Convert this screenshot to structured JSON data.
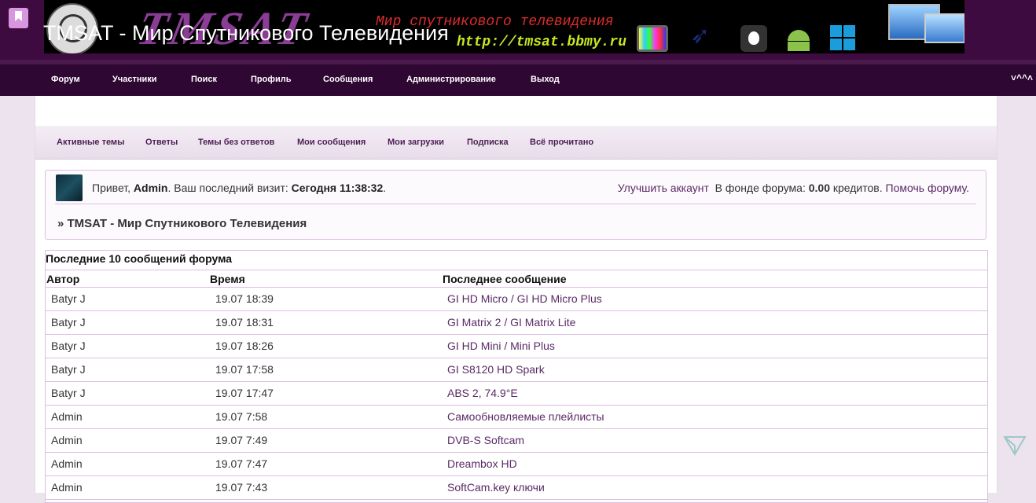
{
  "header": {
    "site_title": "TMSAT - Мир Спутникового Телевидения",
    "banner_logo": "TMSAT",
    "banner_tagline": "Мир спутникового телевидения",
    "banner_url": "http://tmsat.bbmy.ru",
    "icons": [
      "bookmark-icon",
      "satellite-dish-icon",
      "tv-icon",
      "rocket-icon",
      "apple-icon",
      "android-icon",
      "windows-icon",
      "computer-icon"
    ]
  },
  "nav": {
    "items": [
      "Форум",
      "Участники",
      "Поиск",
      "Профиль",
      "Сообщения",
      "Администрирование",
      "Выход"
    ],
    "scroll_label": "˅^^˄"
  },
  "subnav": {
    "items": [
      "Активные темы",
      "Ответы",
      "Темы без ответов",
      "Мои сообщения",
      "Мои загрузки",
      "Подписка",
      "Всё прочитано"
    ]
  },
  "welcome": {
    "greet_prefix": "Привет,",
    "username": "Admin",
    "last_visit_label": ". Ваш последний визит:",
    "last_visit_value": "Сегодня 11:38:32",
    "upgrade_link": "Улучшить аккаунт",
    "fund_label": "В фонде форума:",
    "fund_value": "0.00",
    "fund_unit": "кредитов.",
    "help_link": "Помочь форуму.",
    "crumb": "» TMSAT - Мир Спутникового Телевидения"
  },
  "latest": {
    "title": "Последние 10 сообщений форума",
    "columns": [
      "Автор",
      "Время",
      "Последнее сообщение"
    ],
    "rows": [
      {
        "author": "Batyr J",
        "time": "19.07 18:39",
        "message": "GI HD Micro / GI HD Micro Plus"
      },
      {
        "author": "Batyr J",
        "time": "19.07 18:31",
        "message": "GI Matrix 2 / GI Matrix Lite"
      },
      {
        "author": "Batyr J",
        "time": "19.07 18:26",
        "message": "GI HD Mini / Mini Plus"
      },
      {
        "author": "Batyr J",
        "time": "19.07 17:58",
        "message": "GI S8120 HD Spark"
      },
      {
        "author": "Batyr J",
        "time": "19.07 17:47",
        "message": "ABS 2, 74.9°E"
      },
      {
        "author": "Admin",
        "time": "19.07 7:58",
        "message": "Самообновляемые плейлисты"
      },
      {
        "author": "Admin",
        "time": "19.07 7:49",
        "message": "DVB-S Softcam"
      },
      {
        "author": "Admin",
        "time": "19.07 7:47",
        "message": "Dreambox HD"
      },
      {
        "author": "Admin",
        "time": "19.07 7:43",
        "message": "SoftCam.key ключи"
      }
    ]
  },
  "colors": {
    "header_bg": "#3e0b40",
    "nav_bg": "#2f0733",
    "page_bg": "#ede3ef",
    "link": "#5a2a66"
  }
}
